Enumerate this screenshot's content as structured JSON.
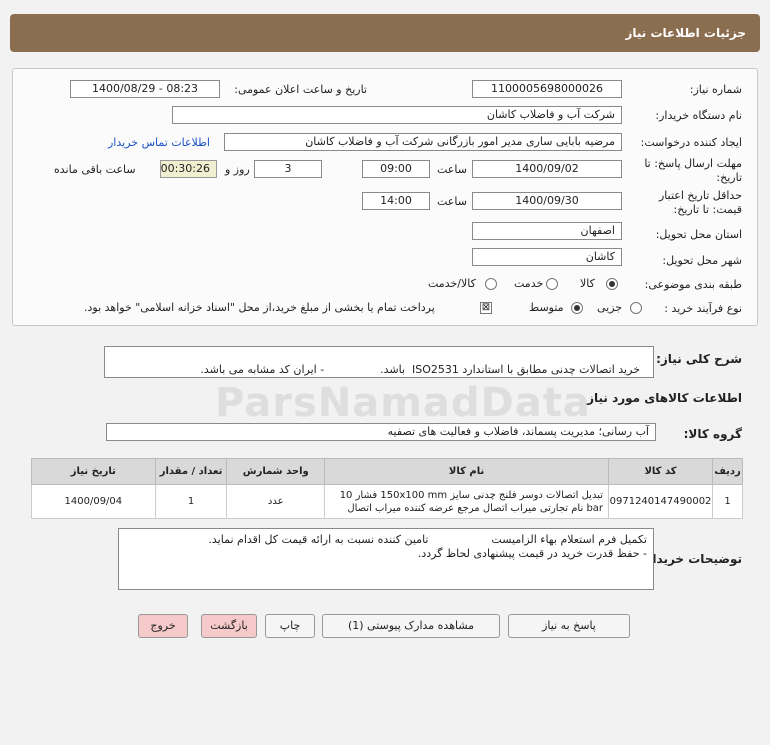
{
  "header": {
    "title": "جزئیات اطلاعات نیاز"
  },
  "form": {
    "need_number_label": "شماره نیاز:",
    "need_number": "1100005698000026",
    "announce_label": "تاریخ و ساعت اعلان عمومی:",
    "announce_value": "1400/08/29 - 08:23",
    "buyer_org_label": "نام دستگاه خریدار:",
    "buyer_org": "شرکت آب و فاضلاب کاشان",
    "requester_label": "ایجاد کننده درخواست:",
    "requester": "مرضیه بابایی ساری مدیر امور بازرگانی شرکت آب و فاضلاب کاشان",
    "contact_link": "اطلاعات تماس خریدار",
    "deadline_label_1": "مهلت ارسال پاسخ: تا",
    "deadline_label_2": "تاریخ:",
    "deadline_date": "1400/09/02",
    "time_label": "ساعت",
    "deadline_time": "09:00",
    "days_value": "3",
    "days_label": "روز و",
    "remaining_time": "00:30:26",
    "remaining_label": "ساعت باقی مانده",
    "validity_label_1": "حداقل تاریخ اعتبار",
    "validity_label_2": "قیمت: تا تاریخ:",
    "validity_date": "1400/09/30",
    "validity_time": "14:00",
    "province_label": "استان محل تحویل:",
    "province": "اصفهان",
    "city_label": "شهر محل تحویل:",
    "city": "کاشان",
    "category_label": "طبقه بندی موضوعی:",
    "category_options": [
      "کالا",
      "خدمت",
      "کالا/خدمت"
    ],
    "category_selected": "کالا",
    "process_label": "نوع فرآیند خرید :",
    "process_options": [
      "جزیی",
      "متوسط"
    ],
    "process_selected": "متوسط",
    "payment_note": "پرداخت تمام یا بخشی از مبلغ خرید،از محل \"اسناد خزانه اسلامی\" خواهد بود."
  },
  "description": {
    "label": "شرح کلی نیاز:",
    "text": "خرید اتصالات چدنی مطابق با استاندارد ISO2531  باشد.                - ایران کد مشابه می باشد."
  },
  "goods_section": {
    "title": "اطلاعات کالاهای مورد نیاز"
  },
  "goods_group": {
    "label": "گروه کالا:",
    "value": "آب رسانی؛ مدیریت پسماند، فاضلاب و فعالیت های تصفیه"
  },
  "table": {
    "headers": [
      "ردیف",
      "کد کالا",
      "نام کالا",
      "واحد شمارش",
      "تعداد / مقدار",
      "تاریخ نیاز"
    ],
    "rows": [
      {
        "row": "1",
        "code": "0971240147490002",
        "name_line1": "تبدیل اتصالات دوسر فلنج چدنی سایز 150x100 mm فشار 10",
        "name_line2": "bar نام تجارتی میراب اتصال مرجع عرضه کننده میراب اتصال",
        "unit": "عدد",
        "qty": "1",
        "date": "1400/09/04"
      }
    ]
  },
  "buyer_notes": {
    "label": "توضیحات خریدار:",
    "line1": "تکمیل فرم استعلام بهاء الزامیست                  تامین کننده نسبت به ارائه قیمت کل اقدام نماید.",
    "line2": "- حفظ قدرت خرید در قیمت پیشنهادی لحاظ گردد."
  },
  "buttons": {
    "reply": "پاسخ به نیاز",
    "attachments": "مشاهده مدارک پیوستی (1)",
    "print": "چاپ",
    "back": "بازگشت",
    "exit": "خروج"
  },
  "watermark": {
    "brand": "ParsNamadData"
  },
  "colors": {
    "header_bg": "#8b6d4f",
    "link": "#1a52c8",
    "timer_bg": "#f1efd0",
    "pink_button": "#f6caca"
  }
}
